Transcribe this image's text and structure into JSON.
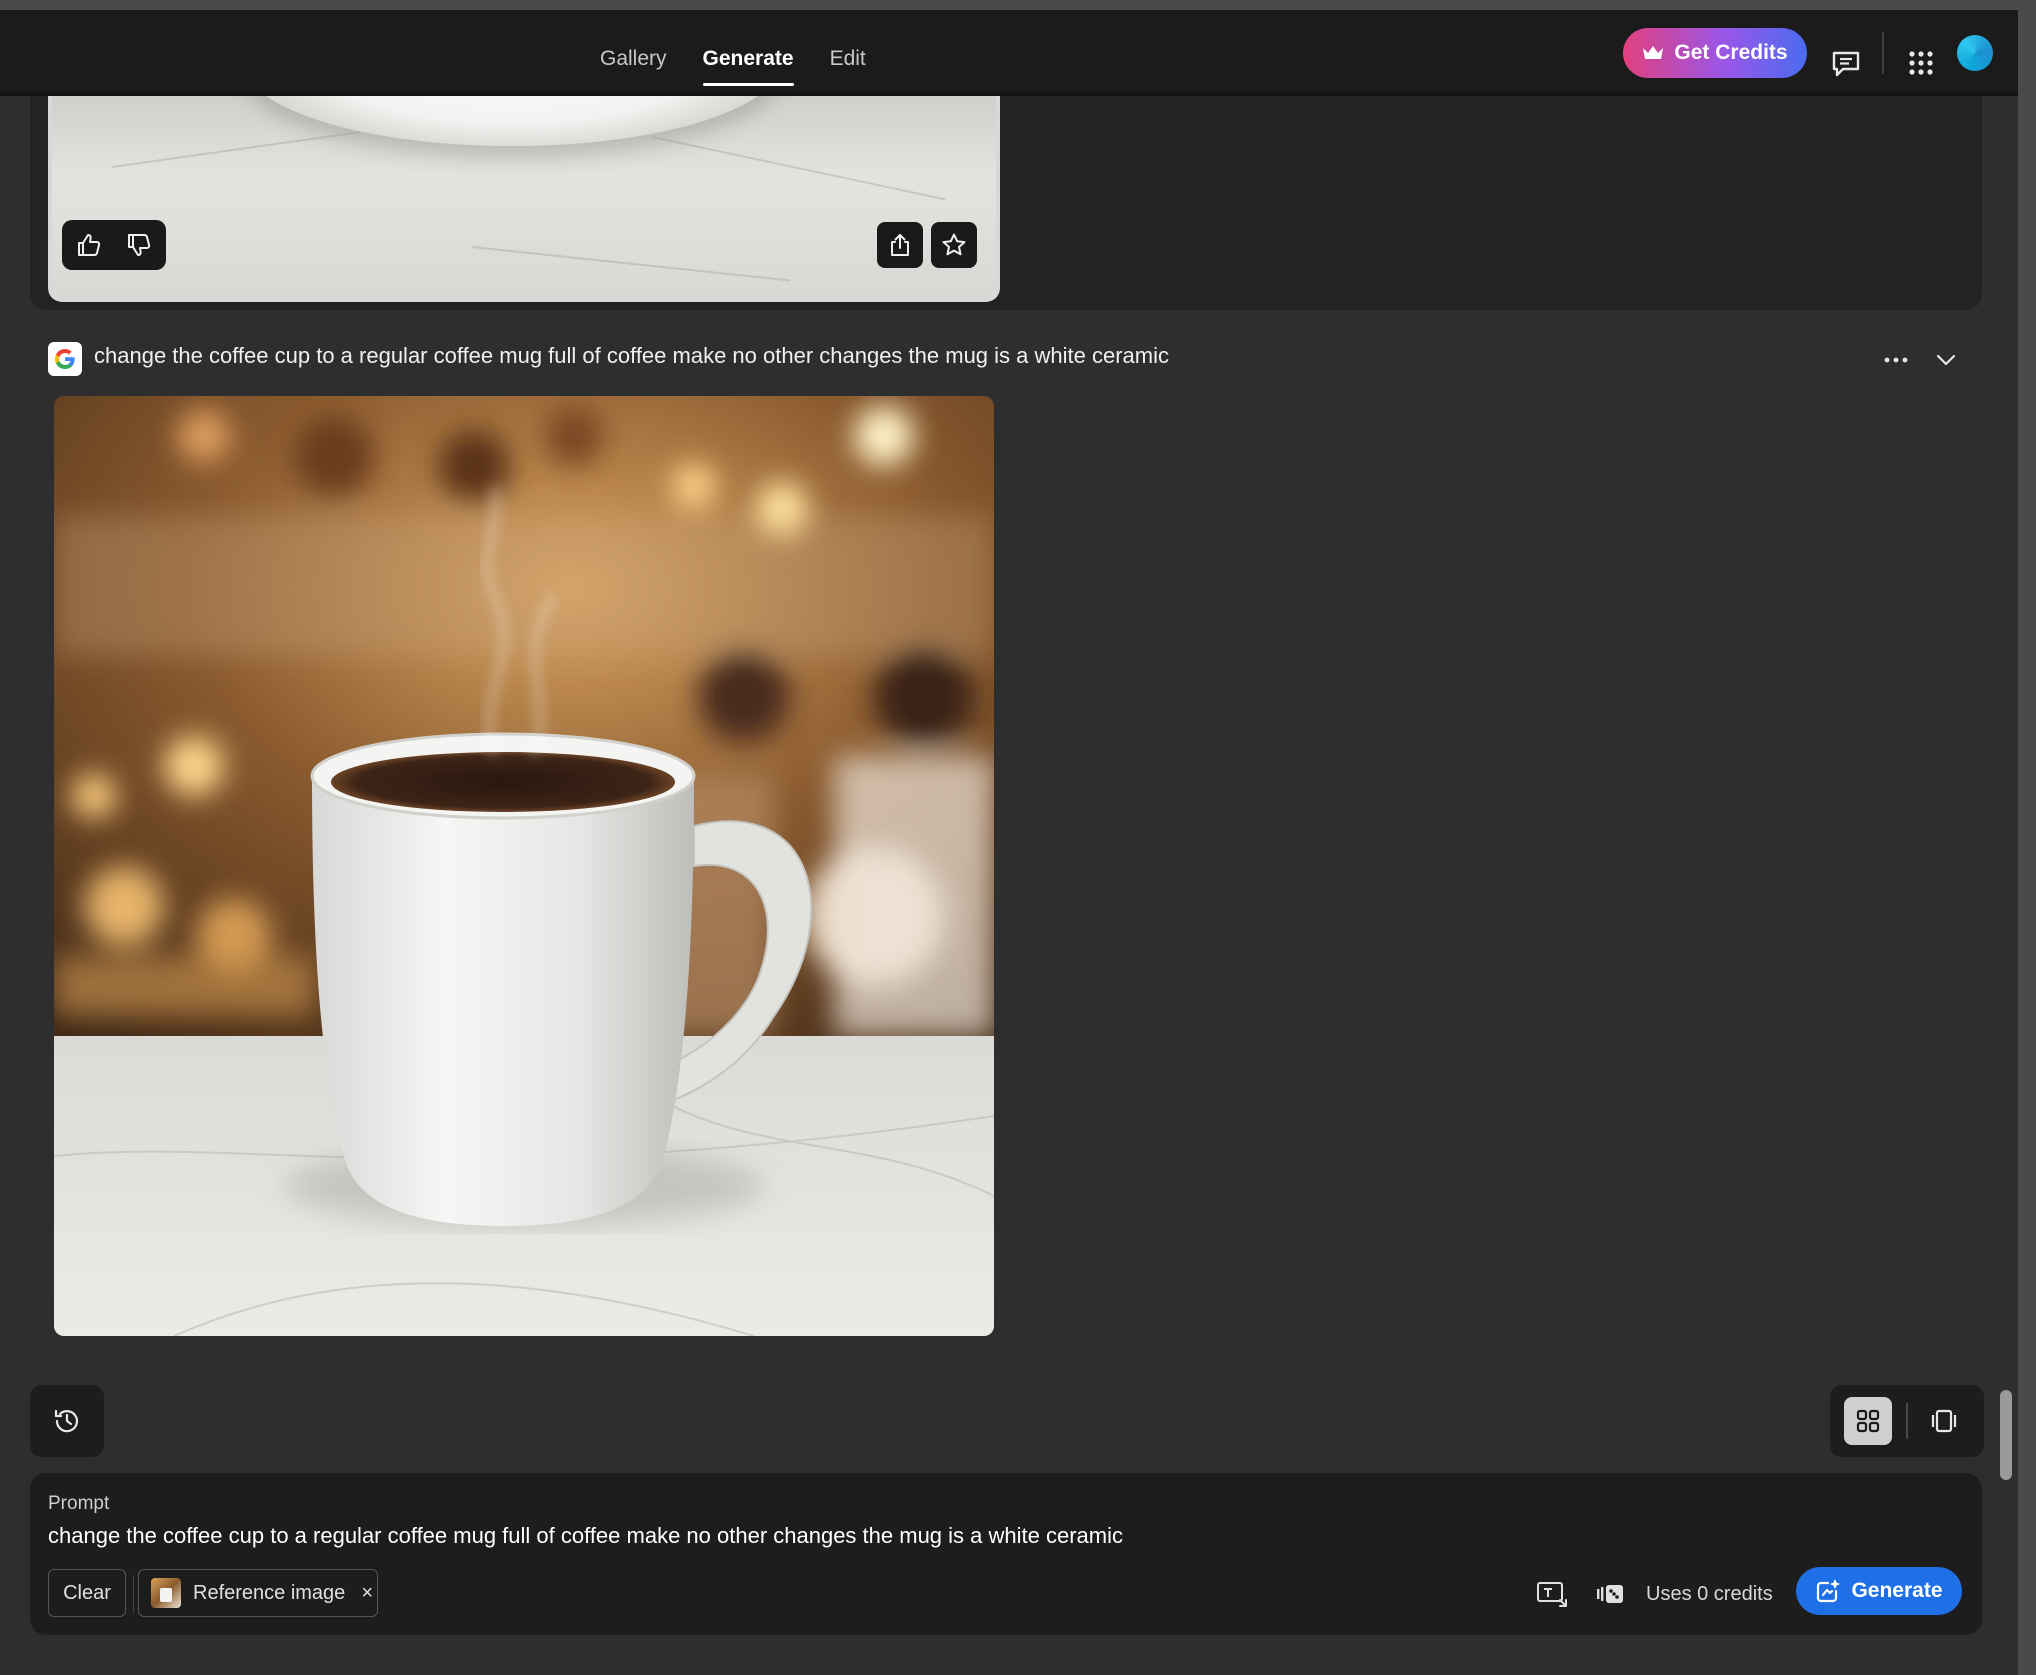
{
  "nav": {
    "tabs": [
      {
        "label": "Gallery",
        "active": false
      },
      {
        "label": "Generate",
        "active": true
      },
      {
        "label": "Edit",
        "active": false
      }
    ],
    "credits_button": "Get Credits",
    "icons": [
      "crown-icon",
      "feedback-icon",
      "apps-grid-icon",
      "avatar"
    ]
  },
  "previous_result": {
    "actions": [
      "thumbs-up-icon",
      "thumbs-down-icon",
      "share-icon",
      "favorite-star-icon"
    ]
  },
  "generation": {
    "model_badge": "google-g-icon",
    "prompt": "change the coffee cup to a regular coffee mug full of coffee make no other changes the mug is a white ceramic",
    "actions": [
      "more-options-icon",
      "collapse-chevron-icon"
    ]
  },
  "view_controls": {
    "history": "history-icon",
    "grid_view": "grid-view-icon",
    "single_view": "single-view-icon"
  },
  "prompt_panel": {
    "label": "Prompt",
    "text": "change the coffee cup to a regular coffee mug full of coffee make no other changes the mug is a white ceramic",
    "clear_label": "Clear",
    "reference_label": "Reference image",
    "reference_close": "×",
    "uses_credits": "Uses 0 credits",
    "generate_label": "Generate"
  },
  "colors": {
    "accent_blue": "#1f6fe6",
    "credits_gradient_start": "#e2407e",
    "credits_gradient_end": "#4a6cf0",
    "background": "#2e2e2e",
    "panel": "#1d1d1d"
  }
}
